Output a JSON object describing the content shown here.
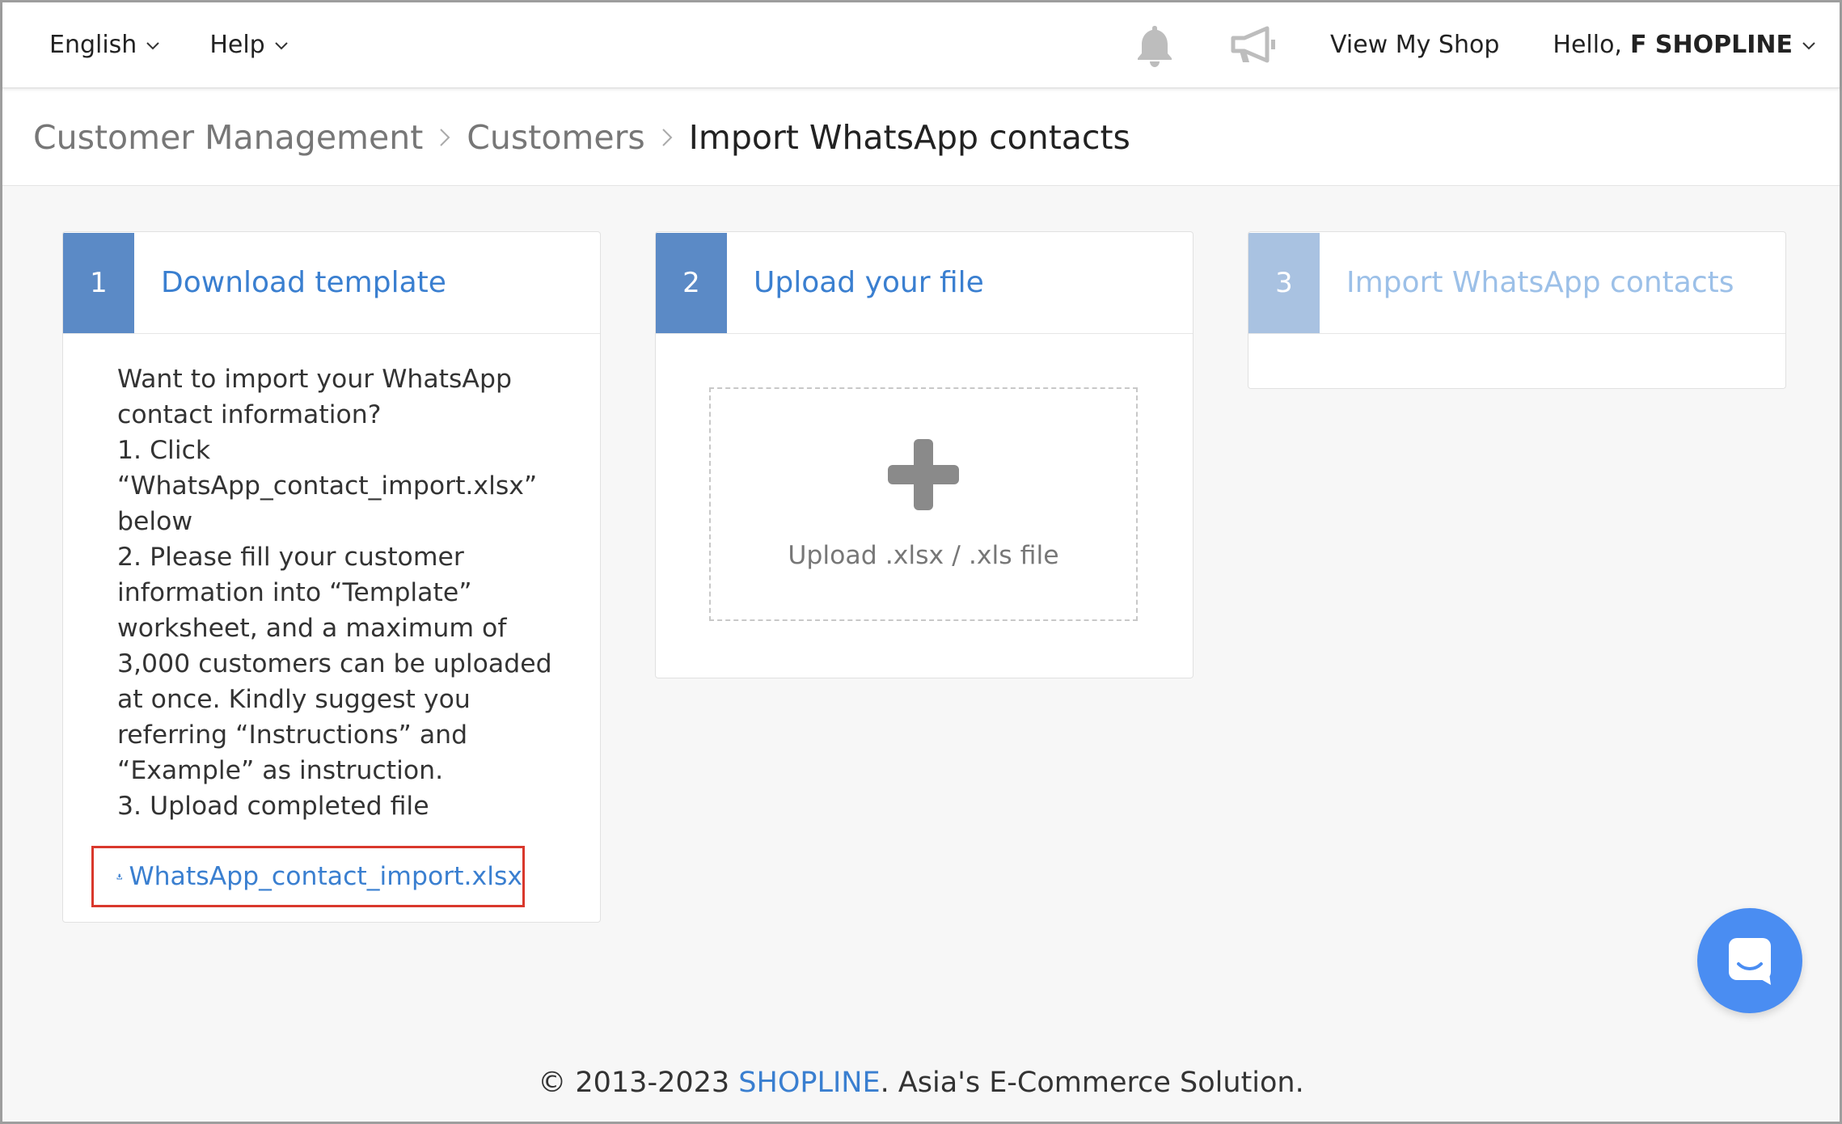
{
  "topbar": {
    "language": "English",
    "help": "Help",
    "view_shop": "View My Shop",
    "hello_prefix": "Hello,",
    "user_name": "F SHOPLINE"
  },
  "breadcrumb": {
    "items": [
      "Customer Management",
      "Customers",
      "Import WhatsApp contacts"
    ]
  },
  "steps": [
    {
      "number": "1",
      "title": "Download template"
    },
    {
      "number": "2",
      "title": "Upload your file"
    },
    {
      "number": "3",
      "title": "Import WhatsApp contacts"
    }
  ],
  "instructions": {
    "lines": [
      "Want to import your WhatsApp contact information?",
      "1. Click “WhatsApp_contact_import.xlsx” below",
      "2. Please fill your customer information into “Template” worksheet, and a maximum of 3,000 customers can be uploaded at once. Kindly suggest you referring “Instructions” and “Example” as instruction.",
      "3. Upload completed file"
    ],
    "download_link": "WhatsApp_contact_import.xlsx"
  },
  "upload": {
    "label": "Upload .xlsx / .xls file"
  },
  "footer": {
    "copyright": "© 2013-2023",
    "brand": "SHOPLINE",
    "tagline": ". Asia's E-Commerce Solution."
  },
  "colors": {
    "accent": "#3a7fd0",
    "step_active": "#5b8ac6",
    "step_inactive": "#a9c2e1",
    "highlight_border": "#d9382c",
    "chat": "#4a8df2"
  }
}
